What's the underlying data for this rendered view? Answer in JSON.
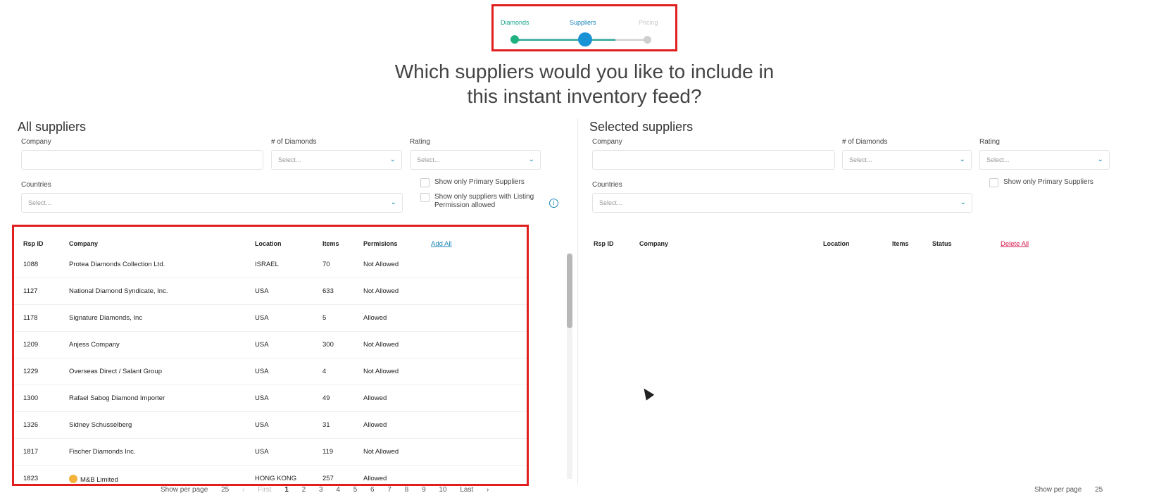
{
  "stepper": {
    "steps": [
      {
        "label": "Diamonds",
        "state": "done"
      },
      {
        "label": "Suppliers",
        "state": "active"
      },
      {
        "label": "Pricing",
        "state": "todo"
      }
    ]
  },
  "question": {
    "line1": "Which suppliers would you like to include in",
    "line2": "this instant inventory feed?"
  },
  "all_suppliers": {
    "title": "All suppliers",
    "filters": {
      "company_label": "Company",
      "diamonds_label": "# of Diamonds",
      "diamonds_placeholder": "Select...",
      "rating_label": "Rating",
      "rating_placeholder": "Select...",
      "countries_label": "Countries",
      "countries_placeholder": "Select...",
      "primary_only": "Show only Primary Suppliers",
      "listing_permission": "Show only suppliers with Listing Permission allowed"
    },
    "columns": [
      "Rsp ID",
      "Company",
      "Location",
      "Items",
      "Permisions"
    ],
    "add_all": "Add All",
    "rows": [
      {
        "id": "1088",
        "company": "Protea Diamonds Collection Ltd.",
        "location": "ISRAEL",
        "items": "70",
        "permission": "Not Allowed"
      },
      {
        "id": "1127",
        "company": "National Diamond Syndicate, Inc.",
        "location": "USA",
        "items": "633",
        "permission": "Not Allowed"
      },
      {
        "id": "1178",
        "company": "Signature Diamonds, Inc",
        "location": "USA",
        "items": "5",
        "permission": "Allowed"
      },
      {
        "id": "1209",
        "company": "Anjess Company",
        "location": "USA",
        "items": "300",
        "permission": "Not Allowed"
      },
      {
        "id": "1229",
        "company": "Overseas Direct / Salant Group",
        "location": "USA",
        "items": "4",
        "permission": "Not Allowed"
      },
      {
        "id": "1300",
        "company": "Rafael Sabog Diamond Importer",
        "location": "USA",
        "items": "49",
        "permission": "Allowed"
      },
      {
        "id": "1326",
        "company": "Sidney Schusselberg",
        "location": "USA",
        "items": "31",
        "permission": "Allowed"
      },
      {
        "id": "1817",
        "company": "Fischer Diamonds Inc.",
        "location": "USA",
        "items": "119",
        "permission": "Not Allowed"
      },
      {
        "id": "1823",
        "company": "M&B Limited",
        "location": "HONG KONG",
        "items": "257",
        "permission": "Allowed"
      }
    ],
    "pager": {
      "show_per_page": "Show per page",
      "per_page": "25",
      "prev": "‹",
      "first": "First",
      "pages": [
        "1",
        "2",
        "3",
        "4",
        "5",
        "6",
        "7",
        "8",
        "9",
        "10"
      ],
      "last": "Last",
      "next": "›"
    }
  },
  "selected_suppliers": {
    "title": "Selected suppliers",
    "filters": {
      "company_label": "Company",
      "diamonds_label": "# of Diamonds",
      "diamonds_placeholder": "Select...",
      "rating_label": "Rating",
      "rating_placeholder": "Select...",
      "countries_label": "Countries",
      "countries_placeholder": "Select...",
      "primary_only": "Show only Primary Suppliers"
    },
    "columns": [
      "Rsp ID",
      "Company",
      "Location",
      "Items",
      "Status"
    ],
    "delete_all": "Delete All",
    "pager": {
      "show_per_page": "Show per page",
      "per_page": "25"
    }
  },
  "colors": {
    "accent": "#1a86b8",
    "done": "#1fb27e",
    "highlight_box": "#e01e1e",
    "delete": "#d3174b"
  }
}
